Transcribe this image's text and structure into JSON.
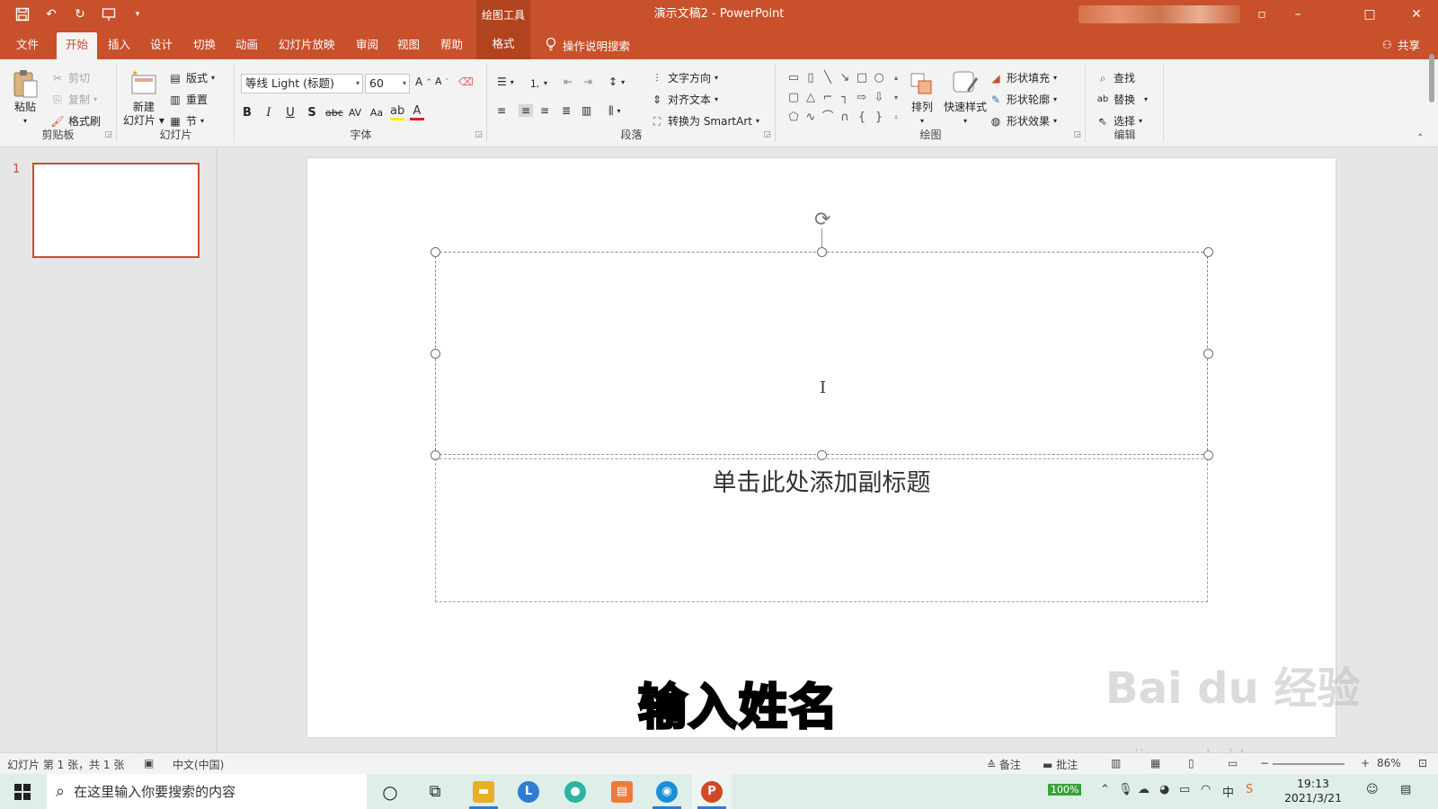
{
  "titlebar": {
    "context_tools": "绘图工具",
    "doc_title": "演示文稿2  -  PowerPoint",
    "qat_icons": [
      "save-icon",
      "undo-icon",
      "redo-icon",
      "present-icon",
      "customize-icon"
    ],
    "window_controls": [
      "restore-icon",
      "minimize-icon",
      "maximize-icon",
      "close-icon"
    ]
  },
  "tabs": {
    "file": "文件",
    "home": "开始",
    "insert": "插入",
    "design": "设计",
    "transitions": "切换",
    "animations": "动画",
    "slideshow": "幻灯片放映",
    "review": "审阅",
    "view": "视图",
    "help": "帮助",
    "format": "格式",
    "tellme": "操作说明搜索",
    "share": "共享"
  },
  "ribbon": {
    "clipboard": {
      "paste": "粘贴",
      "cut": "剪切",
      "copy": "复制",
      "format_painter": "格式刷",
      "label": "剪贴板"
    },
    "slides": {
      "new_slide_1": "新建",
      "new_slide_2": "幻灯片",
      "layout": "版式",
      "reset": "重置",
      "section": "节",
      "label": "幻灯片"
    },
    "font": {
      "font_name": "等线 Light (标题)",
      "font_size": "60",
      "label": "字体"
    },
    "paragraph": {
      "text_direction": "文字方向",
      "align_text": "对齐文本",
      "convert_smartart": "转换为 SmartArt",
      "label": "段落"
    },
    "drawing": {
      "arrange": "排列",
      "quick_styles": "快速样式",
      "shape_fill": "形状填充",
      "shape_outline": "形状轮廓",
      "shape_effects": "形状效果",
      "label": "绘图"
    },
    "editing": {
      "find": "查找",
      "replace": "替换",
      "select": "选择",
      "label": "编辑"
    }
  },
  "thumbnails": {
    "slide_number": "1"
  },
  "slide": {
    "subtitle_placeholder": "单击此处添加副标题"
  },
  "overlay": {
    "caption": "输入姓名",
    "watermark": "Bai du 经验",
    "watermark_url": "jingyan.baidu.com"
  },
  "statusbar": {
    "slide_info": "幻灯片 第 1 张，共 1 张",
    "language": "中文(中国)",
    "notes": "备注",
    "comments": "批注",
    "zoom": "86%"
  },
  "taskbar": {
    "search_placeholder": "在这里输入你要搜索的内容",
    "battery": "100%",
    "time": "19:13",
    "date": "2021/3/21"
  },
  "colors": {
    "accent": "#c8502b",
    "ribbon_bg": "#f3f3f3",
    "workspace": "#e6e6e6",
    "taskbar": "#dfeee9"
  }
}
